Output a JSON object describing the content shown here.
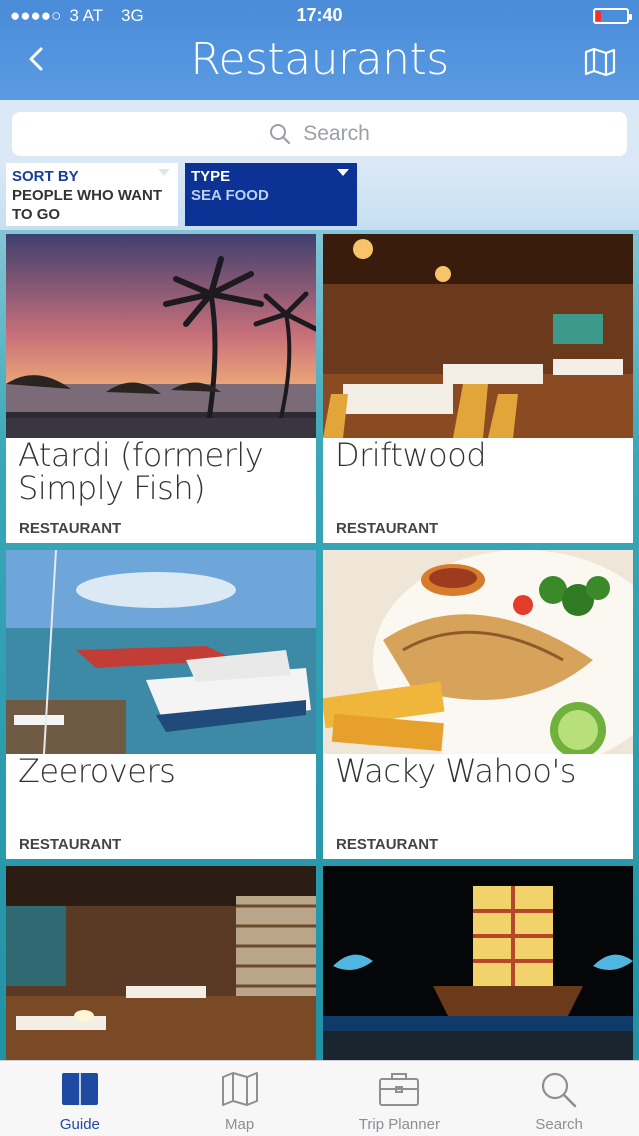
{
  "status": {
    "carrier": "3 AT",
    "network": "3G",
    "time": "17:40",
    "battery_level": 0.15
  },
  "header": {
    "title": "Restaurants",
    "back_icon": "chevron-left-icon",
    "map_icon": "map-icon"
  },
  "search": {
    "placeholder": "Search",
    "icon": "search-icon"
  },
  "filters": {
    "sort": {
      "label": "SORT BY",
      "value": "PEOPLE WHO WANT TO GO"
    },
    "type": {
      "label": "TYPE",
      "value": "SEA FOOD"
    }
  },
  "cards": [
    {
      "name": "Atardi (formerly Simply Fish)",
      "category": "RESTAURANT",
      "image": "beach-sunset-palms"
    },
    {
      "name": "Driftwood",
      "category": "RESTAURANT",
      "image": "rustic-dining-room"
    },
    {
      "name": "Zeerovers",
      "category": "RESTAURANT",
      "image": "fishing-boats-dock"
    },
    {
      "name": "Wacky Wahoo's",
      "category": "RESTAURANT",
      "image": "grilled-fish-plate"
    },
    {
      "name": "",
      "category": "",
      "image": "wine-bar-interior"
    },
    {
      "name": "",
      "category": "",
      "image": "pirate-ship-night"
    }
  ],
  "tabs": [
    {
      "label": "Guide",
      "icon": "book-icon",
      "active": true
    },
    {
      "label": "Map",
      "icon": "map-icon",
      "active": false
    },
    {
      "label": "Trip Planner",
      "icon": "briefcase-icon",
      "active": false
    },
    {
      "label": "Search",
      "icon": "search-icon",
      "active": false
    }
  ],
  "colors": {
    "accent": "#1e4aa1",
    "nav": "#4a8bd8",
    "type_filter": "#0d3295"
  }
}
